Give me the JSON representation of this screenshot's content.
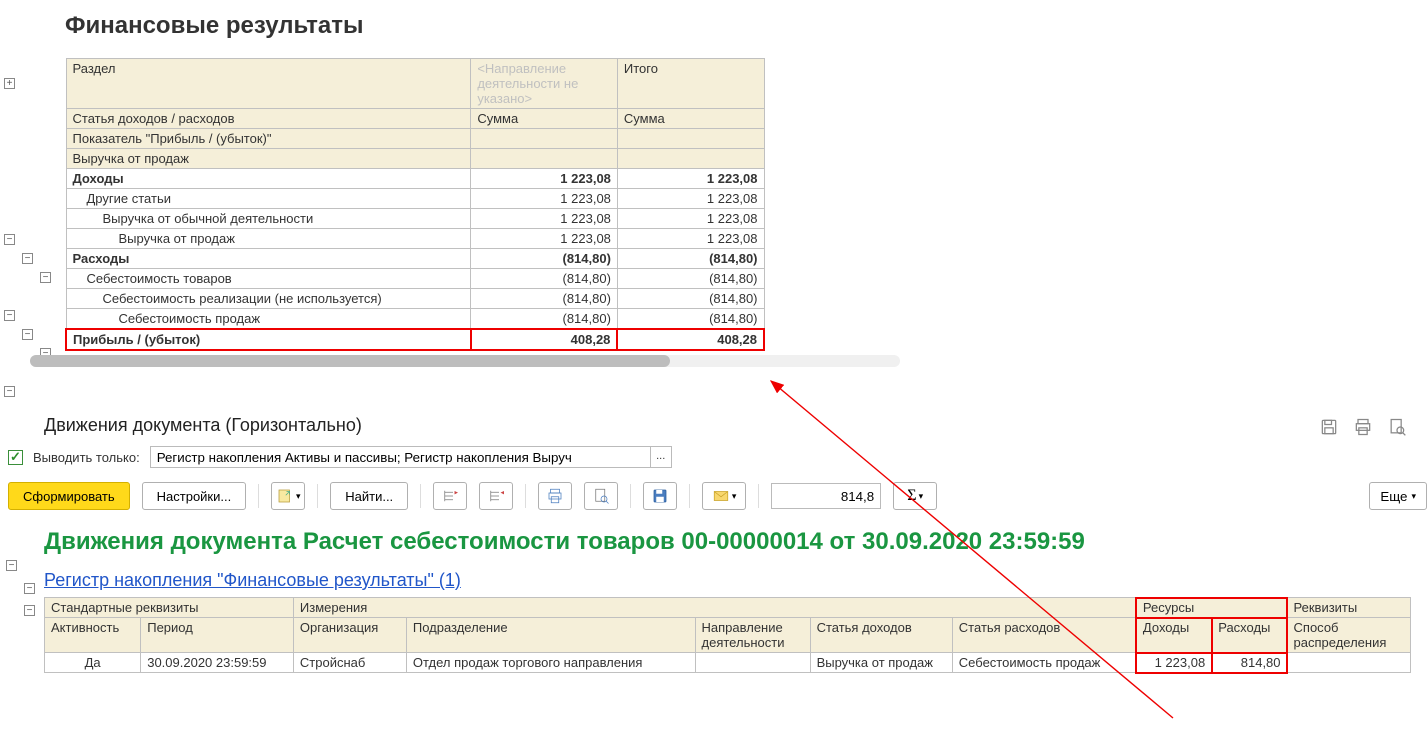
{
  "report": {
    "title": "Финансовые результаты",
    "headers": {
      "section": "Раздел",
      "direction_placeholder": "<Направление деятельности не указано>",
      "total": "Итого",
      "article": "Статья доходов / расходов",
      "sum1": "Сумма",
      "sum2": "Сумма",
      "indicator": "Показатель \"Прибыль / (убыток)\"",
      "revenue": "Выручка от продаж"
    },
    "rows": {
      "income": {
        "label": "Доходы",
        "v1": "1 223,08",
        "v2": "1 223,08"
      },
      "other": {
        "label": "Другие статьи",
        "v1": "1 223,08",
        "v2": "1 223,08"
      },
      "rev_ord": {
        "label": "Выручка от обычной деятельности",
        "v1": "1 223,08",
        "v2": "1 223,08"
      },
      "rev_sales": {
        "label": "Выручка от продаж",
        "v1": "1 223,08",
        "v2": "1 223,08"
      },
      "expense": {
        "label": "Расходы",
        "v1": "(814,80)",
        "v2": "(814,80)"
      },
      "cost_goods": {
        "label": "Себестоимость товаров",
        "v1": "(814,80)",
        "v2": "(814,80)"
      },
      "cost_real": {
        "label": "Себестоимость реализации (не используется)",
        "v1": "(814,80)",
        "v2": "(814,80)"
      },
      "cost_sales": {
        "label": "Себестоимость продаж",
        "v1": "(814,80)",
        "v2": "(814,80)"
      },
      "profit": {
        "label": "Прибыль / (убыток)",
        "v1": "408,28",
        "v2": "408,28"
      }
    }
  },
  "lower": {
    "title": "Движения документа (Горизонтально)",
    "filter_label": "Выводить только:",
    "filter_value": "Регистр накопления Активы и пассивы; Регистр накопления Выруч",
    "btn_form": "Сформировать",
    "btn_settings": "Настройки...",
    "btn_find": "Найти...",
    "search_value": "814,8",
    "btn_more": "Еще",
    "doc_title": "Движения документа Расчет себестоимости товаров 00-00000014 от 30.09.2020 23:59:59",
    "reg_link": "Регистр накопления \"Финансовые результаты\" (1)",
    "table": {
      "group_std": "Стандартные реквизиты",
      "group_dim": "Измерения",
      "group_res": "Ресурсы",
      "group_req": "Реквизиты",
      "cols": {
        "activity": "Активность",
        "period": "Период",
        "org": "Организация",
        "dept": "Подразделение",
        "direction": "Направление деятельности",
        "art_income": "Статья доходов",
        "art_expense": "Статья расходов",
        "income": "Доходы",
        "expense": "Расходы",
        "method": "Способ распределения"
      },
      "row": {
        "activity": "Да",
        "period": "30.09.2020 23:59:59",
        "org": "Стройснаб",
        "dept": "Отдел продаж торгового направления",
        "direction": "",
        "art_income": "Выручка от продаж",
        "art_expense": "Себестоимость продаж",
        "income": "1 223,08",
        "expense": "814,80",
        "method": ""
      }
    }
  }
}
